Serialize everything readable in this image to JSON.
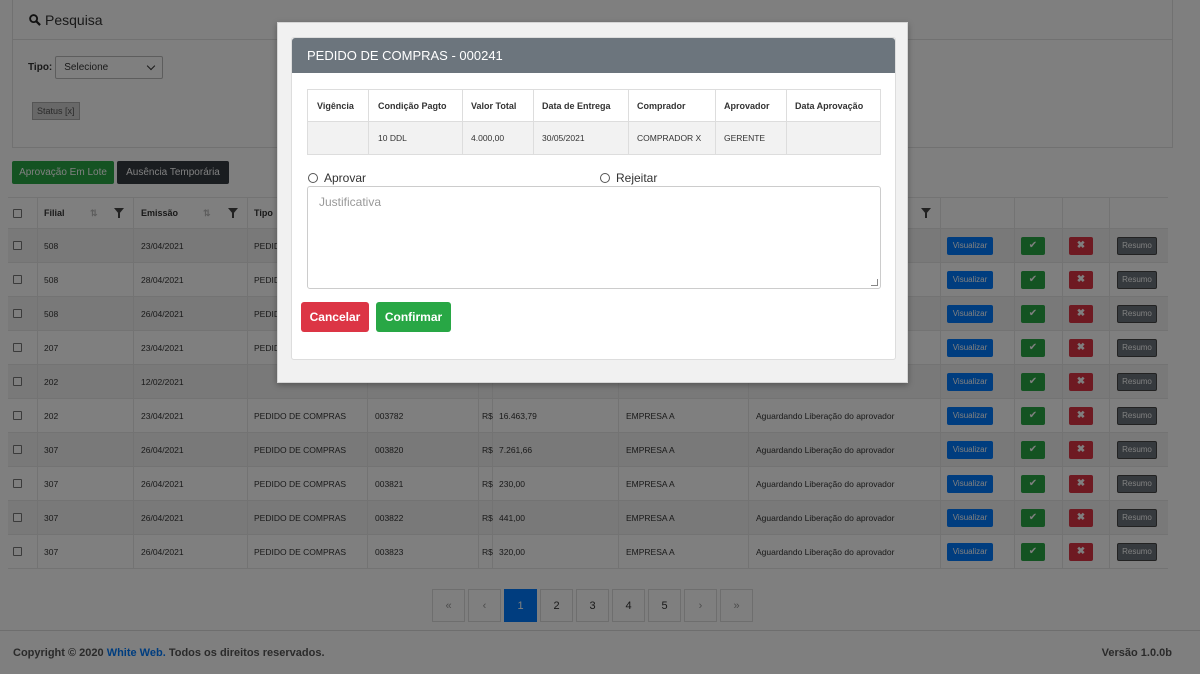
{
  "search": {
    "title": "Pesquisa",
    "tipo_label": "Tipo:",
    "tipo_value": "Selecione",
    "status_tag": "Status [x]"
  },
  "actions": {
    "lote": "Aprovação Em Lote",
    "ausencia": "Ausência Temporária"
  },
  "table": {
    "headers": {
      "filial": "Filial",
      "emissao": "Emissão",
      "tipo": "Tipo"
    },
    "row_buttons": {
      "visualizar": "Visualizar",
      "aprovar": "✔",
      "rejeitar": "✖",
      "resumo": "Resumo"
    },
    "rows": [
      {
        "filial": "508",
        "emissao": "23/04/2021",
        "tipo": "PEDID",
        "numero": "",
        "cur": "",
        "valor": "",
        "empresa": "",
        "status": ""
      },
      {
        "filial": "508",
        "emissao": "28/04/2021",
        "tipo": "PEDID",
        "numero": "",
        "cur": "",
        "valor": "",
        "empresa": "",
        "status": ""
      },
      {
        "filial": "508",
        "emissao": "26/04/2021",
        "tipo": "PEDID",
        "numero": "",
        "cur": "",
        "valor": "",
        "empresa": "",
        "status": ""
      },
      {
        "filial": "207",
        "emissao": "23/04/2021",
        "tipo": "PEDID",
        "numero": "",
        "cur": "",
        "valor": "",
        "empresa": "",
        "status": ""
      },
      {
        "filial": "202",
        "emissao": "12/02/2021",
        "tipo": "",
        "numero": "",
        "cur": "",
        "valor": "",
        "empresa": "",
        "status": ""
      },
      {
        "filial": "202",
        "emissao": "23/04/2021",
        "tipo": "PEDIDO DE COMPRAS",
        "numero": "003782",
        "cur": "R$",
        "valor": "16.463,79",
        "empresa": "EMPRESA A",
        "status": "Aguardando Liberação do aprovador"
      },
      {
        "filial": "307",
        "emissao": "26/04/2021",
        "tipo": "PEDIDO DE COMPRAS",
        "numero": "003820",
        "cur": "R$",
        "valor": "7.261,66",
        "empresa": "EMPRESA A",
        "status": "Aguardando Liberação do aprovador"
      },
      {
        "filial": "307",
        "emissao": "26/04/2021",
        "tipo": "PEDIDO DE COMPRAS",
        "numero": "003821",
        "cur": "R$",
        "valor": "230,00",
        "empresa": "EMPRESA A",
        "status": "Aguardando Liberação do aprovador"
      },
      {
        "filial": "307",
        "emissao": "26/04/2021",
        "tipo": "PEDIDO DE COMPRAS",
        "numero": "003822",
        "cur": "R$",
        "valor": "441,00",
        "empresa": "EMPRESA A",
        "status": "Aguardando Liberação do aprovador"
      },
      {
        "filial": "307",
        "emissao": "26/04/2021",
        "tipo": "PEDIDO DE COMPRAS",
        "numero": "003823",
        "cur": "R$",
        "valor": "320,00",
        "empresa": "EMPRESA A",
        "status": "Aguardando Liberação do aprovador"
      }
    ]
  },
  "pagination": {
    "first": "«",
    "prev": "‹",
    "pages": [
      "1",
      "2",
      "3",
      "4",
      "5"
    ],
    "next": "›",
    "last": "»",
    "active": "1"
  },
  "footer": {
    "prefix": "Copyright © 2020 ",
    "brand": "White Web.",
    "suffix": " Todos os direitos reservados.",
    "version": "Versão 1.0.0b"
  },
  "modal": {
    "title": "PEDIDO DE COMPRAS - 000241",
    "headers": [
      "Vigência",
      "Condição Pagto",
      "Valor Total",
      "Data de Entrega",
      "Comprador",
      "Aprovador",
      "Data Aprovação"
    ],
    "values": [
      "",
      "10 DDL",
      "4.000,00",
      "30/05/2021",
      "COMPRADOR X",
      "GERENTE",
      ""
    ],
    "aprovar_label": "Aprovar",
    "rejeitar_label": "Rejeitar",
    "justificativa_placeholder": "Justificativa",
    "cancel_label": "Cancelar",
    "confirm_label": "Confirmar"
  },
  "colors": {
    "primary": "#007bff",
    "success": "#28a745",
    "danger": "#dc3545",
    "dark": "#343a40",
    "secondary": "#6c757d"
  }
}
